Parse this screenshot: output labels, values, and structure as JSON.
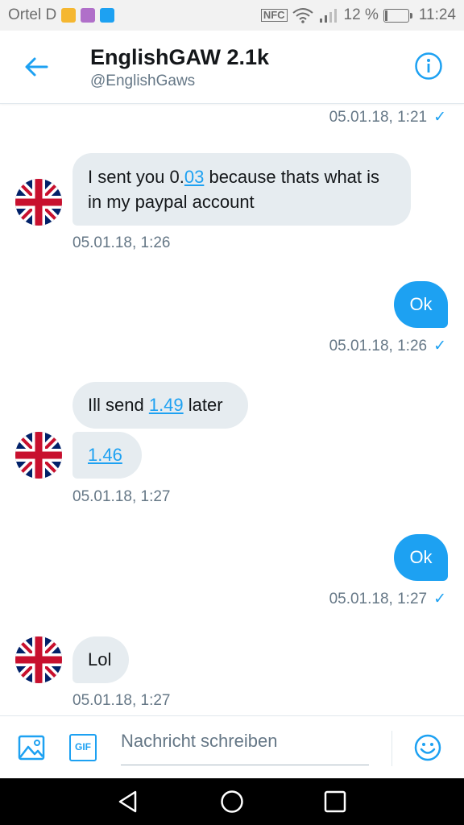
{
  "status_bar": {
    "carrier": "Ortel D",
    "nfc": "NFC",
    "battery": "12 %",
    "battery_level": 0.12,
    "time": "11:24"
  },
  "header": {
    "title": "EnglishGAW 2.1k",
    "handle": "@EnglishGaws"
  },
  "messages": [
    {
      "id": "m0",
      "timestamp": "05.01.18, 1:21",
      "sent": true
    },
    {
      "id": "m1",
      "direction": "in",
      "parts": [
        "I sent you 0.",
        "03",
        " because thats what is in my paypal account"
      ],
      "timestamp": "05.01.18, 1:26"
    },
    {
      "id": "m2",
      "direction": "out",
      "text": "Ok",
      "timestamp": "05.01.18, 1:26"
    },
    {
      "id": "m3",
      "direction": "in",
      "parts": [
        "Ill send ",
        "1.49",
        " later"
      ]
    },
    {
      "id": "m4",
      "direction": "in",
      "text": "1.46",
      "timestamp": "05.01.18, 1:27"
    },
    {
      "id": "m5",
      "direction": "out",
      "text": "Ok",
      "timestamp": "05.01.18, 1:27"
    },
    {
      "id": "m6",
      "direction": "in",
      "text": "Lol",
      "timestamp": "05.01.18, 1:27"
    }
  ],
  "compose": {
    "placeholder": "Nachricht schreiben",
    "gif_label": "GIF"
  },
  "colors": {
    "accent": "#1da1f2",
    "incoming_bubble": "#e6ecf0",
    "timestamp": "#657786"
  },
  "icons": [
    "back-arrow-icon",
    "info-icon",
    "image-icon",
    "gif-icon",
    "emoji-icon",
    "nav-back-icon",
    "nav-home-icon",
    "nav-recents-icon"
  ]
}
